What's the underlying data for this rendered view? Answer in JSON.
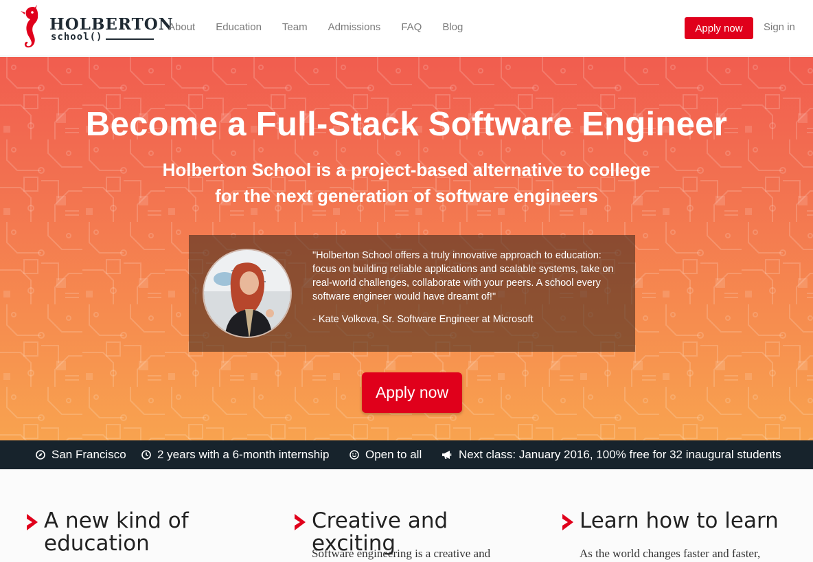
{
  "brand": {
    "name": "HOLBERTON",
    "sub": "school()"
  },
  "nav": {
    "links": [
      "About",
      "Education",
      "Team",
      "Admissions",
      "FAQ",
      "Blog"
    ],
    "apply_label": "Apply now",
    "signin_label": "Sign in"
  },
  "hero": {
    "title": "Become a Full-Stack Software Engineer",
    "subtitle_line1": "Holberton School is a project-based alternative to college",
    "subtitle_line2": "for the next generation of software engineers",
    "quote": "\"Holberton School offers a truly innovative approach to education: focus on building reliable applications and scalable systems, take on real-world challenges, collaborate with your peers. A school every software engineer would have dreamt of!\"",
    "quote_author": "- Kate Volkova, Sr. Software Engineer at Microsoft",
    "apply_label": "Apply now"
  },
  "info": {
    "location": "San Francisco",
    "duration": "2 years with a 6-month internship",
    "audience": "Open to all",
    "next_class": "Next class: January 2016, 100% free for 32 inaugural students"
  },
  "features": [
    {
      "title": "A new kind of education",
      "text": ""
    },
    {
      "title": "Creative and exciting",
      "text": "Software engineering is a creative and"
    },
    {
      "title": "Learn how to learn",
      "text": "As the world changes faster and faster,"
    }
  ],
  "icons": {
    "location": "compass-icon",
    "duration": "clock-icon",
    "audience": "smiley-icon",
    "next_class": "megaphone-icon",
    "feature": "chevron-right-icon"
  },
  "colors": {
    "accent": "#e0001b",
    "hero_top": "#f15d4f",
    "hero_bottom": "#f8a34f",
    "strip": "#17232c",
    "nav_text": "#7a7a7a"
  }
}
